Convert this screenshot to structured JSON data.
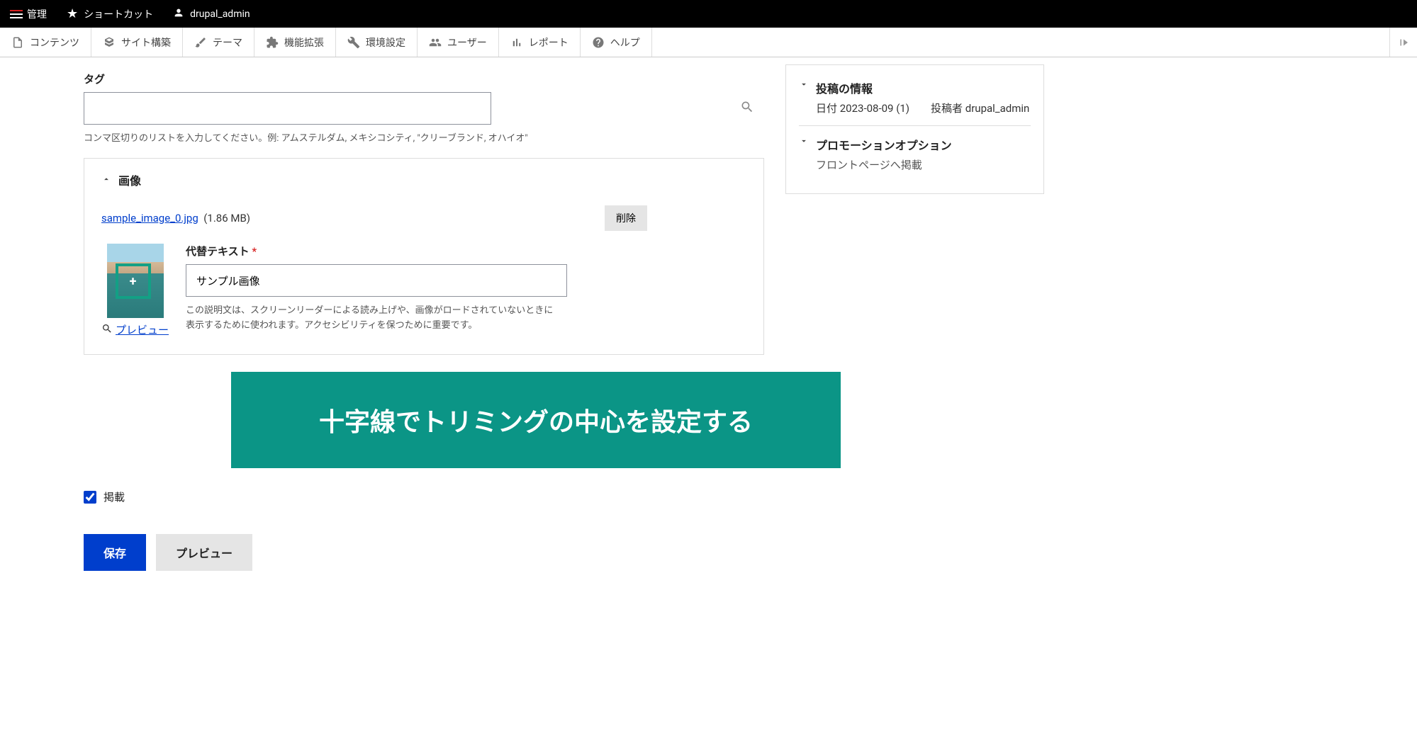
{
  "topbar": {
    "manage": "管理",
    "shortcuts": "ショートカット",
    "user": "drupal_admin"
  },
  "admin_menu": {
    "content": "コンテンツ",
    "structure": "サイト構築",
    "appearance": "テーマ",
    "extend": "機能拡張",
    "configuration": "環境設定",
    "people": "ユーザー",
    "reports": "レポート",
    "help": "ヘルプ"
  },
  "tags": {
    "label": "タグ",
    "help": "コンマ区切りのリストを入力してください。例: アムステルダム, メキシコシティ, \"クリーブランド, オハイオ\""
  },
  "image": {
    "panel_title": "画像",
    "filename": "sample_image_0.jpg",
    "filesize": "(1.86 MB)",
    "remove": "削除",
    "alt_label": "代替テキスト",
    "alt_value": "サンプル画像",
    "alt_help": "この説明文は、スクリーンリーダーによる読み上げや、画像がロードされていないときに表示するために使われます。アクセシビリティを保つために重要です。",
    "preview": "プレビュー"
  },
  "callout": "十字線でトリミングの中心を設定する",
  "publish": {
    "label": "掲載"
  },
  "actions": {
    "save": "保存",
    "preview": "プレビュー"
  },
  "sidebar": {
    "post_info_title": "投稿の情報",
    "post_date_label": "日付",
    "post_date": "2023-08-09",
    "post_revision": "(1)",
    "author_label": "投稿者",
    "author": "drupal_admin",
    "promo_title": "プロモーションオプション",
    "promo_sub": "フロントページへ掲載"
  }
}
